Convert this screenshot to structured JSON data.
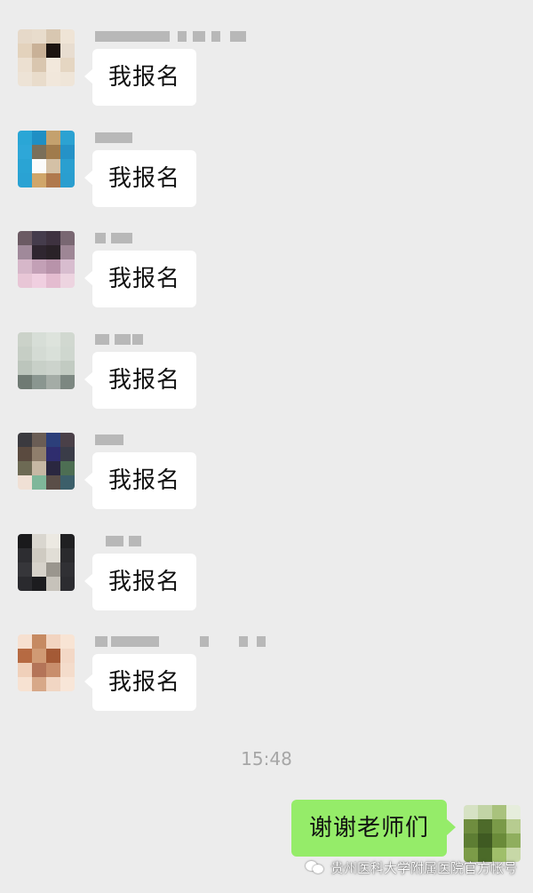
{
  "messages": [
    {
      "text": "我报名",
      "avatar_colors": [
        "#e6d9c9",
        "#e8dccc",
        "#d8c7b1",
        "#efe4d6",
        "#e3d2bc",
        "#c9b197",
        "#1c1410",
        "#e8ddd0",
        "#ece0d1",
        "#d9c6af",
        "#f2e8dc",
        "#e5d6c2",
        "#ede3d6",
        "#e9dccb",
        "#f1e7db",
        "#efe5d8"
      ]
    },
    {
      "text": "我报名",
      "avatar_colors": [
        "#2aa6d6",
        "#1f8fc4",
        "#c4a16e",
        "#2ca2d2",
        "#2ea7d8",
        "#7a6f5a",
        "#a07b4c",
        "#2592c7",
        "#2aa4d4",
        "#fbfbfb",
        "#d4c1a6",
        "#2a9fd0",
        "#2aa2d3",
        "#d0a66a",
        "#b0794d",
        "#2a9ecf"
      ]
    },
    {
      "text": "我报名",
      "avatar_colors": [
        "#6b5a63",
        "#453c4c",
        "#3e3240",
        "#796772",
        "#a0899a",
        "#2f2630",
        "#2a2228",
        "#9e8695",
        "#d6b7c9",
        "#c3a0b6",
        "#b893aa",
        "#d8bdcf",
        "#e8c6d6",
        "#f0cfe0",
        "#e4bcd0",
        "#edd4e0"
      ]
    },
    {
      "text": "我报名",
      "avatar_colors": [
        "#cbd2c9",
        "#d7ded7",
        "#dde3dc",
        "#d1d8d0",
        "#c6cec5",
        "#d4dbd4",
        "#d9e0d9",
        "#cfd7cf",
        "#bcc5bc",
        "#c8d0c8",
        "#ccd3cc",
        "#c2cbc2",
        "#6f7a73",
        "#8a9690",
        "#a4aca6",
        "#7c8781"
      ]
    },
    {
      "text": "我报名",
      "avatar_colors": [
        "#3b3a3f",
        "#6a5d55",
        "#2c3f7a",
        "#4a4048",
        "#5a4a3f",
        "#8f7e6c",
        "#2f2d6e",
        "#3a3c48",
        "#6d6a54",
        "#c6b8a4",
        "#2a2740",
        "#4d6e53",
        "#f0e0d5",
        "#7fb79a",
        "#5a4e48",
        "#3c5f6a"
      ]
    },
    {
      "text": "我报名",
      "avatar_colors": [
        "#1a1a1c",
        "#d9d6cf",
        "#ece9e2",
        "#202022",
        "#2d2d31",
        "#cfcbc2",
        "#e1ded6",
        "#2a2a2d",
        "#36363a",
        "#d6d2ca",
        "#9a968e",
        "#303034",
        "#2a2a2e",
        "#1c1c1f",
        "#c6c2ba",
        "#2c2c30"
      ]
    },
    {
      "text": "我报名",
      "avatar_colors": [
        "#f6e0d0",
        "#c68a62",
        "#f2d4c0",
        "#f8e4d4",
        "#b66a42",
        "#d09a74",
        "#a45a36",
        "#f3d8c6",
        "#f0d0ba",
        "#b47458",
        "#c88e6c",
        "#f4dccb",
        "#f7e2d2",
        "#d7a888",
        "#f1d6c3",
        "#f8e6d8"
      ]
    }
  ],
  "timestamp": "15:48",
  "my_message": {
    "text": "谢谢老师们",
    "avatar_colors": [
      "#d6e2c4",
      "#c2d4a6",
      "#a9c27d",
      "#e6eddc",
      "#6f8d3f",
      "#4d6a2a",
      "#7a9a48",
      "#b7cc90",
      "#5d7d33",
      "#3f5a22",
      "#6a8b39",
      "#8fae5e",
      "#7c9c48",
      "#4b6a29",
      "#9fbf6a",
      "#c7d8a7"
    ]
  },
  "watermark": {
    "text": "贵州医科大学附属医院官方帐号"
  }
}
